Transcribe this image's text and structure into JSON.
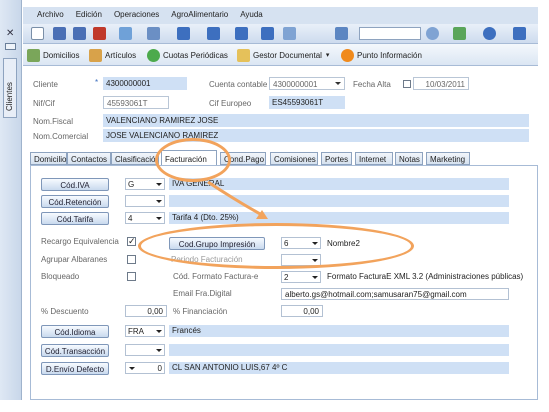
{
  "menu": [
    "Archivo",
    "Edición",
    "Operaciones",
    "AgroAlimentario",
    "Ayuda"
  ],
  "side_tab": "Clientes",
  "modules": [
    "Domicilios",
    "Artículos",
    "Cuotas Periódicas",
    "Gestor Documental",
    "Punto Información"
  ],
  "header": {
    "cliente_label": "Cliente",
    "cliente_value": "4300000001",
    "cuenta_label": "Cuenta contable",
    "cuenta_value": "4300000001",
    "fecha_label": "Fecha Alta",
    "fecha_value": "10/03/2011",
    "nif_label": "Nif/Cif",
    "nif_value": "45593061T",
    "cifeu_label": "Cif Europeo",
    "cifeu_value": "ES45593061T",
    "fiscal_label": "Nom.Fiscal",
    "fiscal_value": "VALENCIANO RAMIREZ JOSE",
    "comercial_label": "Nom.Comercial",
    "comercial_value": "JOSE VALENCIANO RAMIREZ"
  },
  "tabs": [
    "Domicilio",
    "Contactos",
    "Clasificació",
    "Facturación",
    "Cond.Pago",
    "Comisiones",
    "Portes",
    "Internet",
    "Notas",
    "Marketing"
  ],
  "form": {
    "iva_btn": "Cód.IVA",
    "iva_code": "G",
    "iva_desc": "IVA GENERAL",
    "retencion_btn": "Cód.Retención",
    "tarifa_btn": "Cód.Tarifa",
    "tarifa_code": "4",
    "tarifa_desc": "Tarifa 4 (Dto. 25%)",
    "recargo_label": "Recargo Equivalencia",
    "agrupar_label": "Agrupar Albaranes",
    "bloqueado_label": "Bloqueado",
    "grupo_btn": "Cod.Grupo Impresión",
    "grupo_code": "6",
    "grupo_desc": "Nombre2",
    "periodo_label": "Periodo Facturación",
    "formato_label": "Cód. Formato Factura-e",
    "formato_code": "2",
    "formato_desc": "Formato FacturaE XML 3.2 (Administraciones públicas)",
    "email_label": "Email Fra.Digital",
    "email_value": "alberto.gs@hotmail.com;samusaran75@gmail.com",
    "descuento_label": "% Descuento",
    "descuento_value": "0,00",
    "financiacion_label": "% Financiación",
    "financiacion_value": "0,00",
    "idioma_btn": "Cód.Idioma",
    "idioma_code": "FRA",
    "idioma_desc": "Francés",
    "transaccion_btn": "Cód.Transacción",
    "envio_btn": "D.Envío Defecto",
    "envio_code": "0",
    "envio_desc": "CL SAN ANTONIO LUIS,67 4º C"
  },
  "colors": {
    "highlight": "#f2a35c",
    "field_blue": "#cfe0f5",
    "tab_blue": "#d5e1ef"
  }
}
